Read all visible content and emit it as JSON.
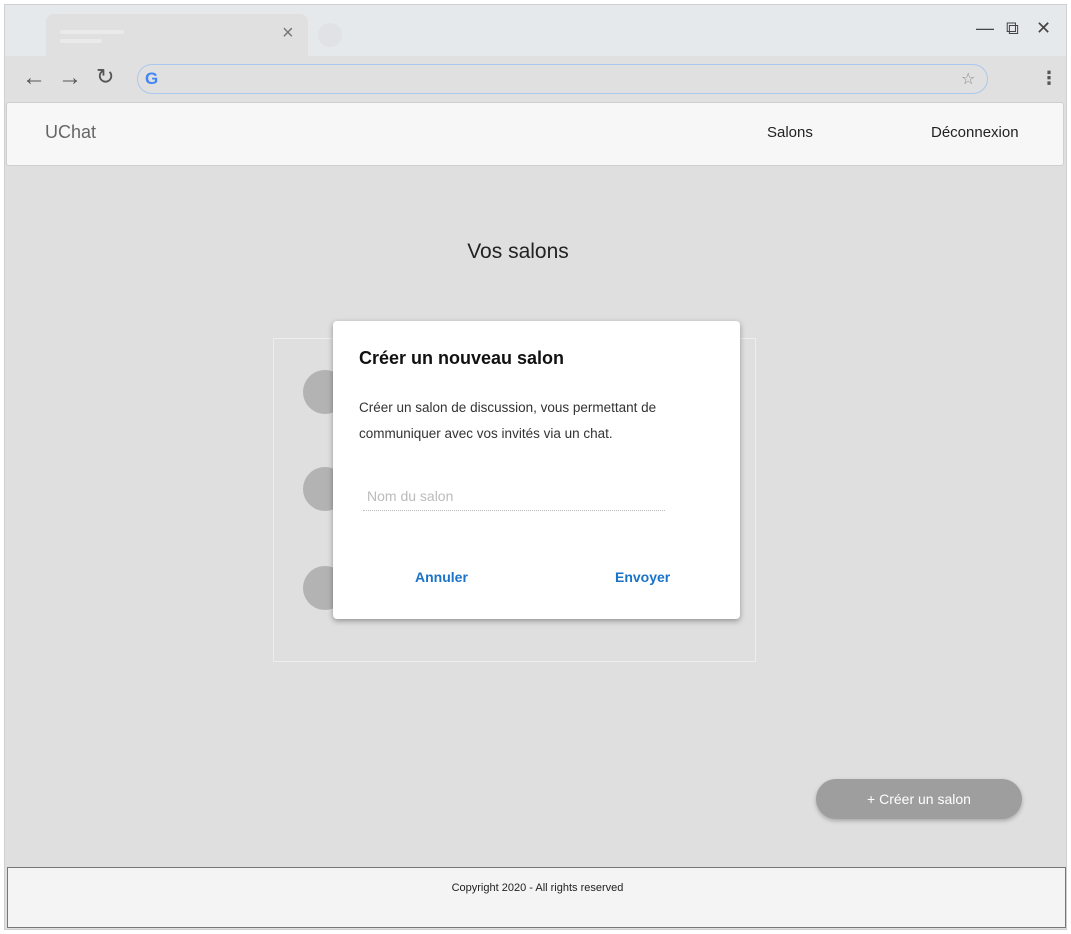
{
  "browser": {
    "tab_close_icon": "×",
    "address_value": "",
    "window_controls": [
      "minimize-icon",
      "restore-icon",
      "close-icon"
    ]
  },
  "navbar": {
    "brand": "UChat",
    "links": [
      "Salons",
      "Déconnexion"
    ]
  },
  "main": {
    "title": "Vos salons",
    "create_button": "+ Créer un salon"
  },
  "modal": {
    "title": "Créer un nouveau salon",
    "description": "Créer un salon de discussion, vous permettant de communiquer avec vos invités via un chat.",
    "input_placeholder": "Nom du salon",
    "input_value": "",
    "cancel": "Annuler",
    "submit": "Envoyer"
  },
  "footer": {
    "copyright": "Copyright 2020 - All rights reserved"
  },
  "colors": {
    "accent": "#1a73c8",
    "fab": "#9e9e9e",
    "background": "#dfdfdf"
  }
}
